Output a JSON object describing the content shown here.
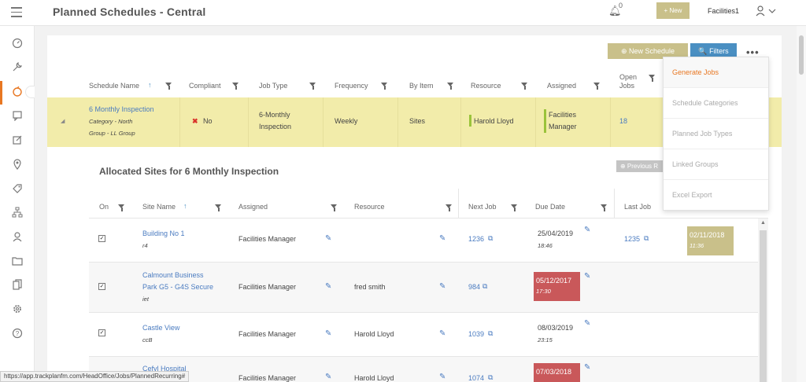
{
  "topbar": {
    "title": "Planned Schedules - Central",
    "notification_count": "0",
    "new_label": "+ New",
    "user_name": "Facilities1"
  },
  "toolbar": {
    "new_schedule_label": "⊕ New Schedule",
    "filters_label": "🔍 Filters",
    "more_label": "•••"
  },
  "schedules_table": {
    "headers": [
      "Schedule Name",
      "Compliant",
      "Job Type",
      "Frequency",
      "By Item",
      "Resource",
      "Assigned",
      "Open Jobs"
    ],
    "open_jobs_header": [
      "Open",
      "Jobs"
    ],
    "row": {
      "name": "6 Monthly Inspection",
      "category_line1": "Category - North",
      "category_line2": "Group - LL Group",
      "compliant": "No",
      "job_type_line1": "6-Monthly",
      "job_type_line2": "Inspection",
      "frequency": "Weekly",
      "by_item": "Sites",
      "resource": "Harold Lloyd",
      "assigned_line1": "Facilities",
      "assigned_line2": "Manager",
      "open_jobs": "18"
    }
  },
  "allocated": {
    "title": "Allocated Sites for 6 Monthly Inspection",
    "previous_label": "⊕ Previous R",
    "headers": [
      "On",
      "Site Name",
      "Assigned",
      "Resource",
      "Next Job",
      "Due Date",
      "Last Job"
    ],
    "rows": [
      {
        "site": "Building No 1",
        "site2": "",
        "code": "r4",
        "assigned": "Facilities Manager",
        "resource": "",
        "next_job": "1236",
        "due_date": "25/04/2019",
        "due_time": "18:46",
        "last_job": "1235",
        "last_date": "02/11/2018",
        "last_time": "11:36"
      },
      {
        "site": "Calmount Business",
        "site2": "Park G5 - G4S Secure",
        "code": "iet",
        "assigned": "Facilities Manager",
        "resource": "fred smith",
        "next_job": "984",
        "due_date": "05/12/2017",
        "due_time": "17:30",
        "last_job": "",
        "last_date": "",
        "last_time": ""
      },
      {
        "site": "Castle View",
        "site2": "",
        "code": "ccB",
        "assigned": "Facilities Manager",
        "resource": "Harold Lloyd",
        "next_job": "1039",
        "due_date": "08/03/2019",
        "due_time": "23:15",
        "last_job": "",
        "last_date": "",
        "last_time": ""
      },
      {
        "site": "Cefyl Hospital",
        "site2": "",
        "code": "",
        "assigned": "Facilities Manager",
        "resource": "Harold Lloyd",
        "next_job": "1074",
        "due_date": "07/03/2018",
        "due_time": "",
        "last_job": "",
        "last_date": "",
        "last_time": ""
      }
    ]
  },
  "dropdown": {
    "items": [
      "Generate Jobs",
      "Schedule Categories",
      "Planned Job Types",
      "Linked Groups",
      "Excel Export"
    ]
  },
  "statusbar": {
    "url": "https://app.trackplanfm.com/HeadOffice/Jobs/PlannedRecurring#"
  },
  "colors": {
    "accent_orange": "#e87722",
    "olive": "#c9c08a",
    "blue": "#4a8fc2",
    "highlight_row": "#f2ecaa",
    "overdue_red": "#c9585a"
  }
}
